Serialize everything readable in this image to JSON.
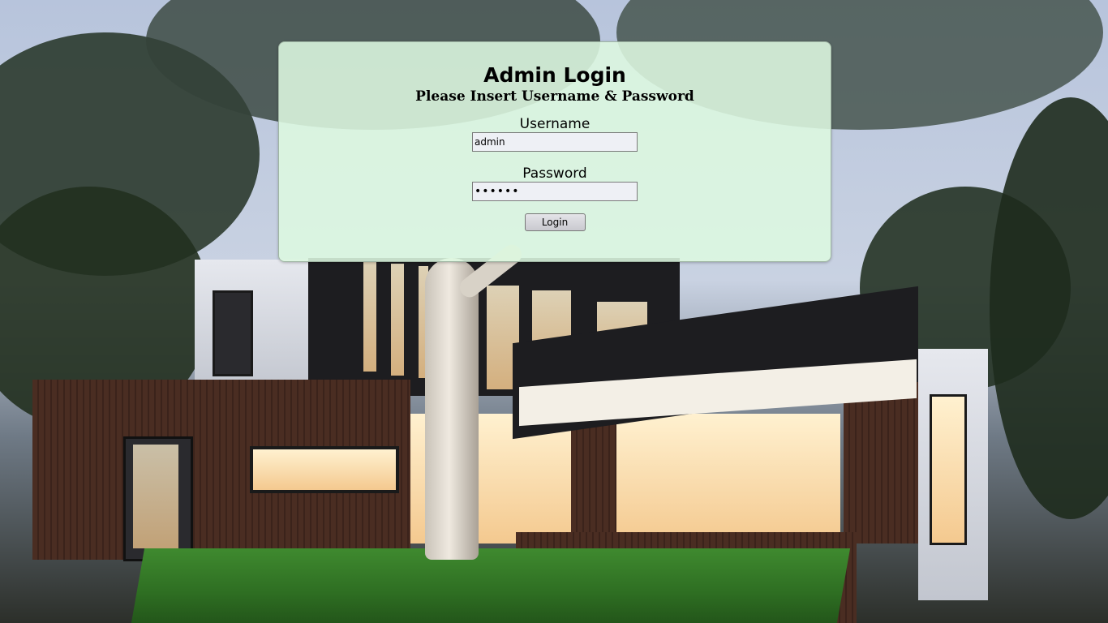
{
  "login": {
    "title": "Admin Login",
    "subtitle": "Please Insert Username & Password",
    "username_label": "Username",
    "username_value": "admin",
    "password_label": "Password",
    "password_value": "••••••",
    "button_label": "Login"
  },
  "colors": {
    "panel_background": "#ddf8e0",
    "panel_border": "#9fb5a3"
  }
}
